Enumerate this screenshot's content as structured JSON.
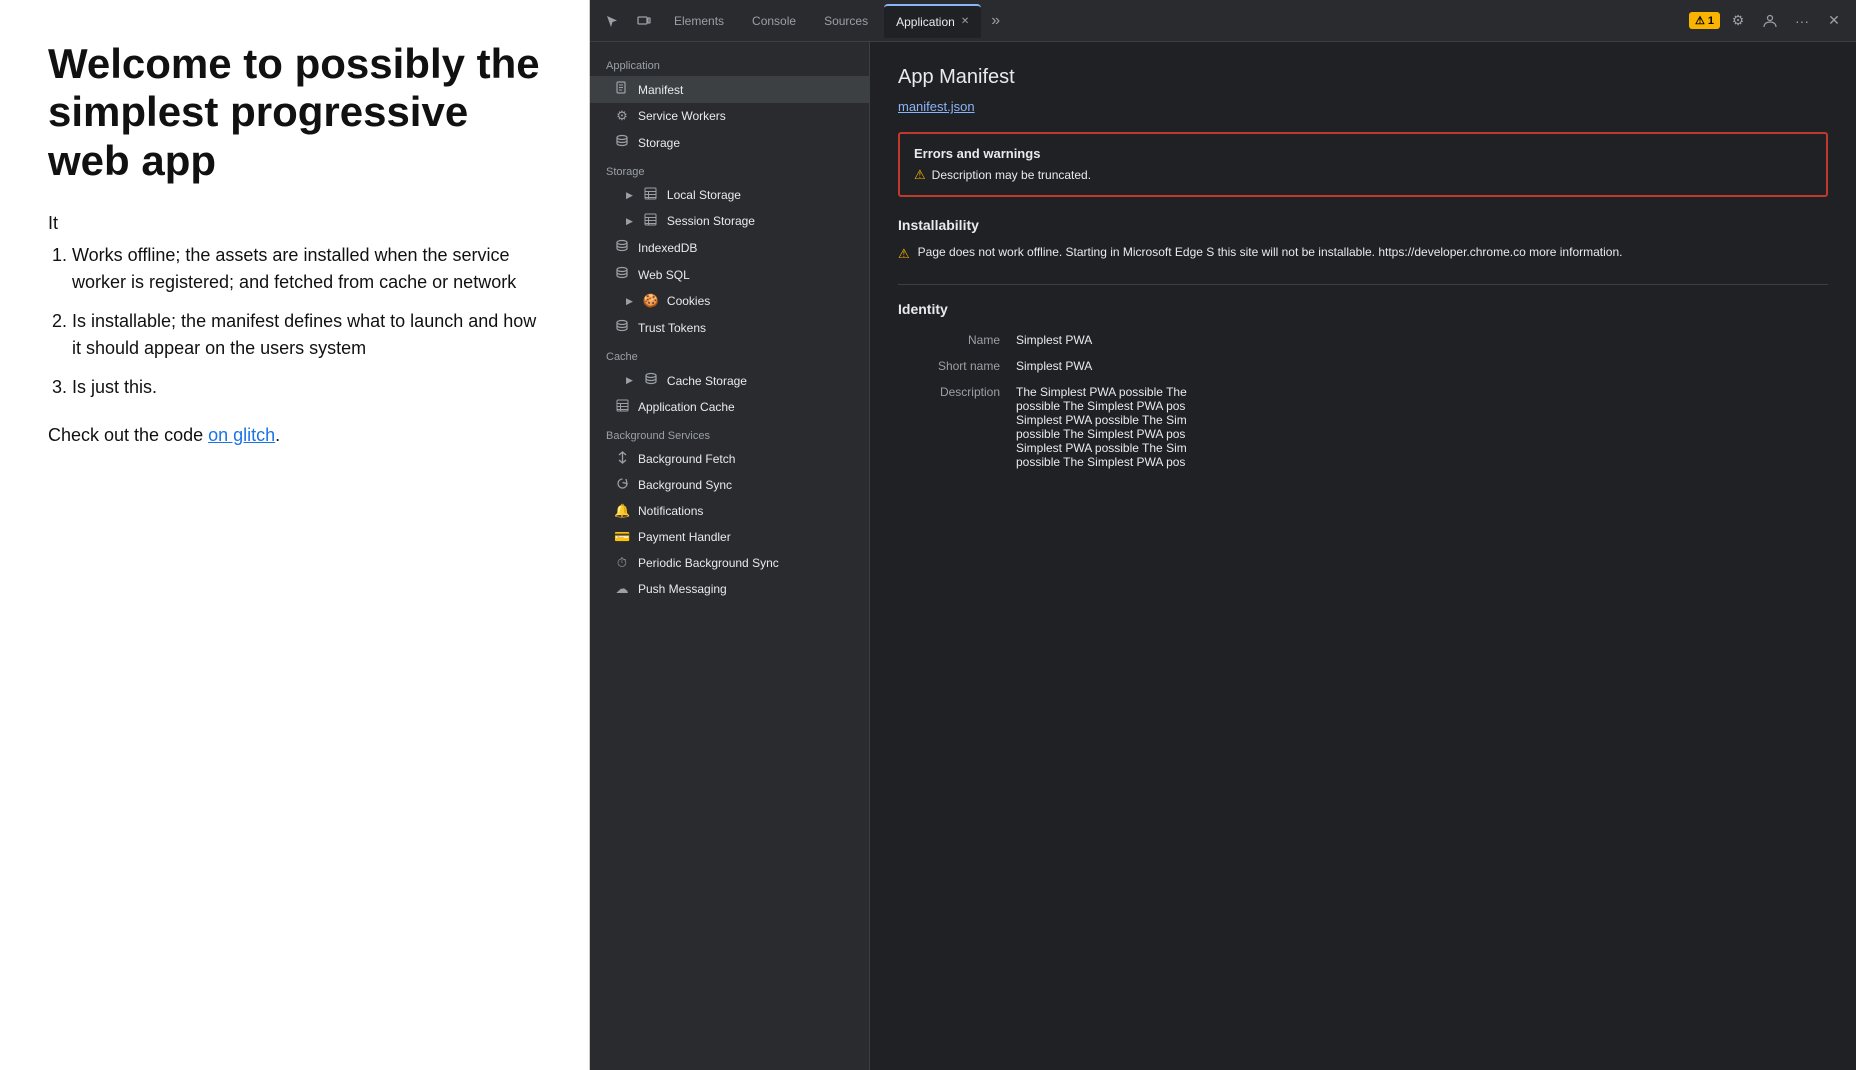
{
  "webpage": {
    "title": "Welcome to possibly the simplest progressive web app",
    "intro": "It",
    "list": [
      "Works offline; the assets are installed when the service worker is registered; and fetched from cache or network",
      "Is installable; the manifest defines what to launch and how it should appear on the users system",
      "Is just this."
    ],
    "footer_text": "Check out the code ",
    "footer_link_text": "on glitch",
    "footer_suffix": "."
  },
  "devtools": {
    "tabbar": {
      "cursor_icon": "⬚",
      "device_icon": "▭",
      "tabs": [
        {
          "label": "Elements",
          "active": false
        },
        {
          "label": "Console",
          "active": false
        },
        {
          "label": "Sources",
          "active": false
        },
        {
          "label": "Application",
          "active": true
        }
      ],
      "more_icon": "»",
      "warn_count": "1",
      "settings_icon": "⚙",
      "profile_icon": "⚇",
      "more_btn": "···",
      "close_icon": "✕"
    },
    "sidebar": {
      "sections": [
        {
          "label": "Application",
          "items": [
            {
              "icon": "📄",
              "label": "Manifest",
              "active": true,
              "indent": 0
            },
            {
              "icon": "⚙",
              "label": "Service Workers",
              "active": false,
              "indent": 0
            },
            {
              "icon": "🗄",
              "label": "Storage",
              "active": false,
              "indent": 0
            }
          ]
        },
        {
          "label": "Storage",
          "items": [
            {
              "arrow": "▶",
              "icon": "▦",
              "label": "Local Storage",
              "active": false,
              "indent": 1
            },
            {
              "arrow": "▶",
              "icon": "▦",
              "label": "Session Storage",
              "active": false,
              "indent": 1
            },
            {
              "icon": "🗄",
              "label": "IndexedDB",
              "active": false,
              "indent": 0
            },
            {
              "icon": "🗄",
              "label": "Web SQL",
              "active": false,
              "indent": 0
            },
            {
              "arrow": "▶",
              "icon": "🍪",
              "label": "Cookies",
              "active": false,
              "indent": 1
            },
            {
              "icon": "🗄",
              "label": "Trust Tokens",
              "active": false,
              "indent": 0
            }
          ]
        },
        {
          "label": "Cache",
          "items": [
            {
              "arrow": "▶",
              "icon": "🗄",
              "label": "Cache Storage",
              "active": false,
              "indent": 1
            },
            {
              "icon": "▦",
              "label": "Application Cache",
              "active": false,
              "indent": 0
            }
          ]
        },
        {
          "label": "Background Services",
          "items": [
            {
              "icon": "↕",
              "label": "Background Fetch",
              "active": false,
              "indent": 0
            },
            {
              "icon": "↻",
              "label": "Background Sync",
              "active": false,
              "indent": 0
            },
            {
              "icon": "🔔",
              "label": "Notifications",
              "active": false,
              "indent": 0
            },
            {
              "icon": "💳",
              "label": "Payment Handler",
              "active": false,
              "indent": 0
            },
            {
              "icon": "⏱",
              "label": "Periodic Background Sync",
              "active": false,
              "indent": 0
            },
            {
              "icon": "☁",
              "label": "Push Messaging",
              "active": false,
              "indent": 0
            }
          ]
        }
      ]
    },
    "main": {
      "title": "App Manifest",
      "manifest_link": "manifest.json",
      "errors_title": "Errors and warnings",
      "error_items": [
        "Description may be truncated."
      ],
      "installability_title": "Installability",
      "installability_text": "Page does not work offline. Starting in Microsoft Edge S this site will not be installable. https://developer.chrome.co more information.",
      "identity_title": "Identity",
      "identity_rows": [
        {
          "label": "Name",
          "value": "Simplest PWA"
        },
        {
          "label": "Short name",
          "value": "Simplest PWA"
        },
        {
          "label": "Description",
          "value_lines": [
            "The Simplest PWA possible The",
            "possible The Simplest PWA pos",
            "Simplest PWA possible The Sim",
            "possible The Simplest PWA pos",
            "Simplest PWA possible The Sim",
            "possible The Simplest PWA pos"
          ]
        }
      ]
    }
  }
}
